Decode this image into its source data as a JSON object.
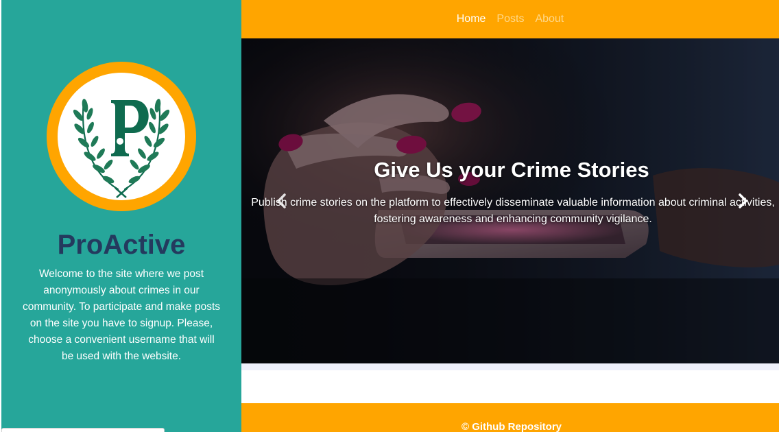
{
  "sidebar": {
    "brand": "ProActive",
    "welcome_text": "Welcome to the site where we post anonymously about crimes in our community. To participate and make posts on the site you have to signup. Please, choose a convenient username that will be used with the website.",
    "logo_icon": "laurel-p-logo"
  },
  "nav": {
    "items": [
      {
        "label": "Home",
        "active": true
      },
      {
        "label": "Posts",
        "active": false
      },
      {
        "label": "About",
        "active": false
      }
    ]
  },
  "carousel": {
    "title": "Give Us your Crime Stories",
    "text": "Publish crime stories on the platform to effectively disseminate valuable information about criminal activities, fostering awareness and enhancing community vigilance.",
    "prev_icon": "chevron-left-icon",
    "next_icon": "chevron-right-icon"
  },
  "footer": {
    "link": "© Github Repository"
  },
  "colors": {
    "sidebar_bg": "#26a69a",
    "accent": "#ffa500",
    "brand_text": "#243a5e",
    "logo_green": "#0f6b4f"
  }
}
